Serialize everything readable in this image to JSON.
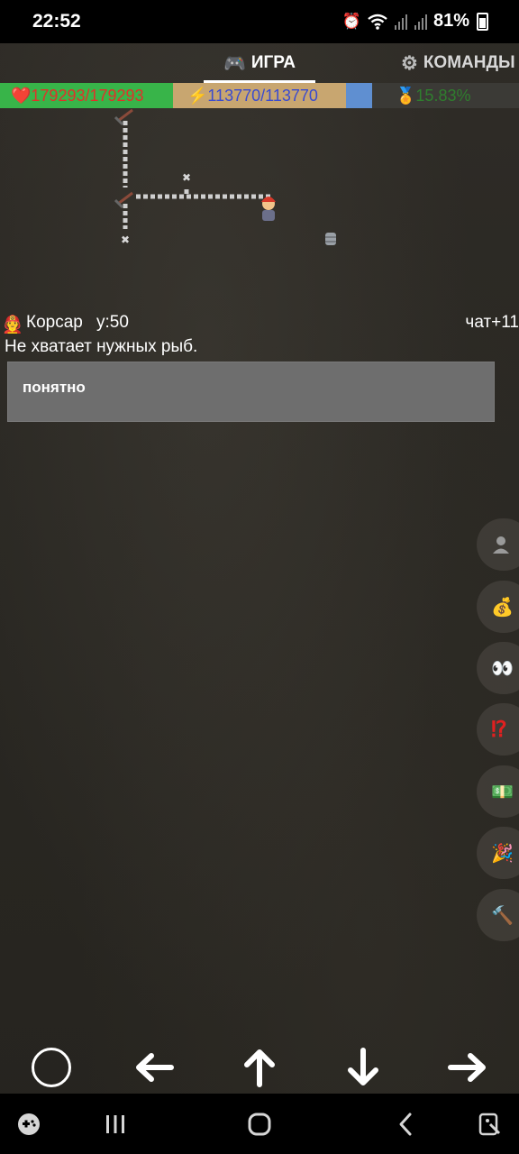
{
  "status_bar": {
    "time": "22:52",
    "battery": "81%",
    "icons": [
      "alarm-icon",
      "wifi-icon",
      "signal-icon",
      "signal-icon",
      "battery-icon"
    ]
  },
  "tabs": [
    {
      "label": "ИГРА",
      "icon": "gamepad-icon",
      "active": true
    },
    {
      "label": "КОМАНДЫ",
      "icon": "gear-icon",
      "active": false
    }
  ],
  "stats": {
    "hp": "❤️179293/179293",
    "mp": "⚡113770/113770",
    "exp": "15.83%"
  },
  "chat": {
    "npc_name": "Корсар",
    "npc_level": "у:50",
    "chat_link": "чат+11",
    "message": "Не хватает нужных рыб.",
    "answer": "понятно"
  },
  "side_buttons": [
    {
      "name": "profile-button",
      "icon": "person-icon"
    },
    {
      "name": "money-bag-button",
      "icon": "money-bag-icon"
    },
    {
      "name": "eyes-button",
      "icon": "eyes-icon"
    },
    {
      "name": "interrobang-button",
      "icon": "interrobang-icon"
    },
    {
      "name": "banknote-button",
      "icon": "banknote-icon"
    },
    {
      "name": "party-button",
      "icon": "party-popper-icon"
    },
    {
      "name": "hammer-button",
      "icon": "hammer-icon"
    }
  ],
  "colors": {
    "hp_bg": "#38b449",
    "hp_text": "#e0312a",
    "mp_bg": "#c8a670",
    "mp_text": "#3a4bd0",
    "exp_text": "#2f7e2e",
    "button_bg": "#6e6e6e"
  }
}
